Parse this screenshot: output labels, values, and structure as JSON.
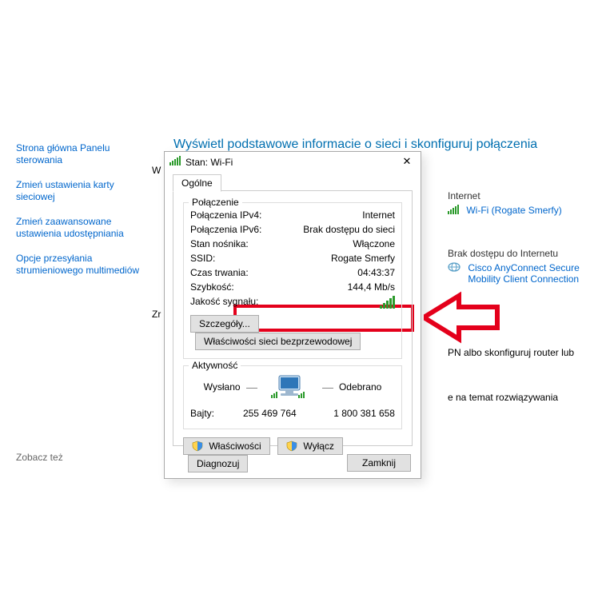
{
  "sidebar": {
    "items": [
      "Strona główna Panelu sterowania",
      "Zmień ustawienia karty sieciowej",
      "Zmień zaawansowane ustawienia udostępniania",
      "Opcje przesyłania strumieniowego multimediów"
    ],
    "see_also": "Zobacz też"
  },
  "main": {
    "heading": "Wyświetl podstawowe informacie o sieci i skonfiguruj połączenia",
    "left_partial_1": "W",
    "left_partial_2": "Zr"
  },
  "right": {
    "internet_hdr": "Internet",
    "wifi_link": "Wi-Fi (Rogate Smerfy)",
    "noaccess_hdr": "Brak dostępu do Internetu",
    "cisco_link": "Cisco AnyConnect Secure Mobility Client Connection",
    "vpn_partial": "PN albo skonfiguruj router lub",
    "trouble_partial": "e na temat rozwiązywania"
  },
  "dialog": {
    "title": "Stan: Wi-Fi",
    "tab": "Ogólne",
    "grp_conn": "Połączenie",
    "rows": {
      "ipv4_k": "Połączenia IPv4:",
      "ipv4_v": "Internet",
      "ipv6_k": "Połączenia IPv6:",
      "ipv6_v": "Brak dostępu do sieci",
      "media_k": "Stan nośnika:",
      "media_v": "Włączone",
      "ssid_k": "SSID:",
      "ssid_v": "Rogate Smerfy",
      "dur_k": "Czas trwania:",
      "dur_v": "04:43:37",
      "spd_k": "Szybkość:",
      "spd_v": "144,4 Mb/s",
      "sigq_k": "Jakość sygnału:"
    },
    "btn_details": "Szczegóły...",
    "btn_wprops": "Właściwości sieci bezprzewodowej",
    "grp_activity": "Aktywność",
    "sent": "Wysłano",
    "recv": "Odebrano",
    "bytes_k": "Bajty:",
    "bytes_sent": "255 469 764",
    "bytes_recv": "1 800 381 658",
    "btn_props": "Właściwości",
    "btn_disable": "Wyłącz",
    "btn_diag": "Diagnozuj",
    "btn_close": "Zamknij"
  }
}
